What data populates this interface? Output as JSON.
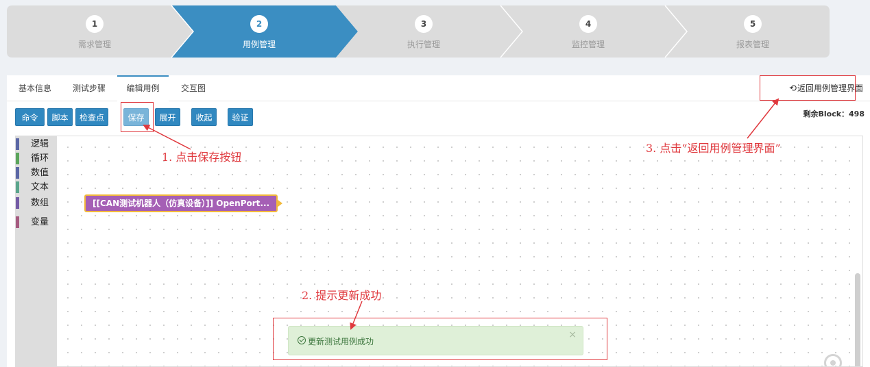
{
  "stepper": {
    "steps": [
      {
        "num": "1",
        "label": "需求管理"
      },
      {
        "num": "2",
        "label": "用例管理"
      },
      {
        "num": "3",
        "label": "执行管理"
      },
      {
        "num": "4",
        "label": "监控管理"
      },
      {
        "num": "5",
        "label": "报表管理"
      }
    ],
    "active_index": 1,
    "active_color": "#3b8ec2",
    "inactive_color": "#dcdcdc"
  },
  "tabs": [
    {
      "label": "基本信息"
    },
    {
      "label": "测试步骤"
    },
    {
      "label": "编辑用例"
    },
    {
      "label": "交互图"
    }
  ],
  "return_link": {
    "icon": "return-arrow-icon",
    "arrow": "⟲",
    "label": "返回用例管理界面"
  },
  "toolbar": {
    "buttons": [
      {
        "label": "命令"
      },
      {
        "label": "脚本"
      },
      {
        "label": "检查点"
      },
      {
        "label": "保存"
      },
      {
        "label": "展开"
      },
      {
        "label": "收起"
      },
      {
        "label": "验证"
      }
    ]
  },
  "remaining": "剩余Block：498",
  "toolbox": {
    "categories": [
      {
        "label": "逻辑",
        "color": "#5b67a5"
      },
      {
        "label": "循环",
        "color": "#5ba55b"
      },
      {
        "label": "数值",
        "color": "#5b67a5"
      },
      {
        "label": "文本",
        "color": "#5ba58c"
      },
      {
        "label": "数组",
        "color": "#745ba5"
      },
      {
        "label": "变量",
        "color": "#a55b80"
      }
    ]
  },
  "block": {
    "label": "[[CAN测试机器人（仿真设备）]] OpenPort...",
    "color": "#a55fb5",
    "border_color": "#f2b93b"
  },
  "toast": {
    "text": "更新测试用例成功",
    "close": "×"
  },
  "annotations": {
    "step1": "1. 点击保存按钮",
    "step2": "2. 提示更新成功",
    "step3": "3. 点击“返回用例管理界面”",
    "color": "#e0393e"
  }
}
